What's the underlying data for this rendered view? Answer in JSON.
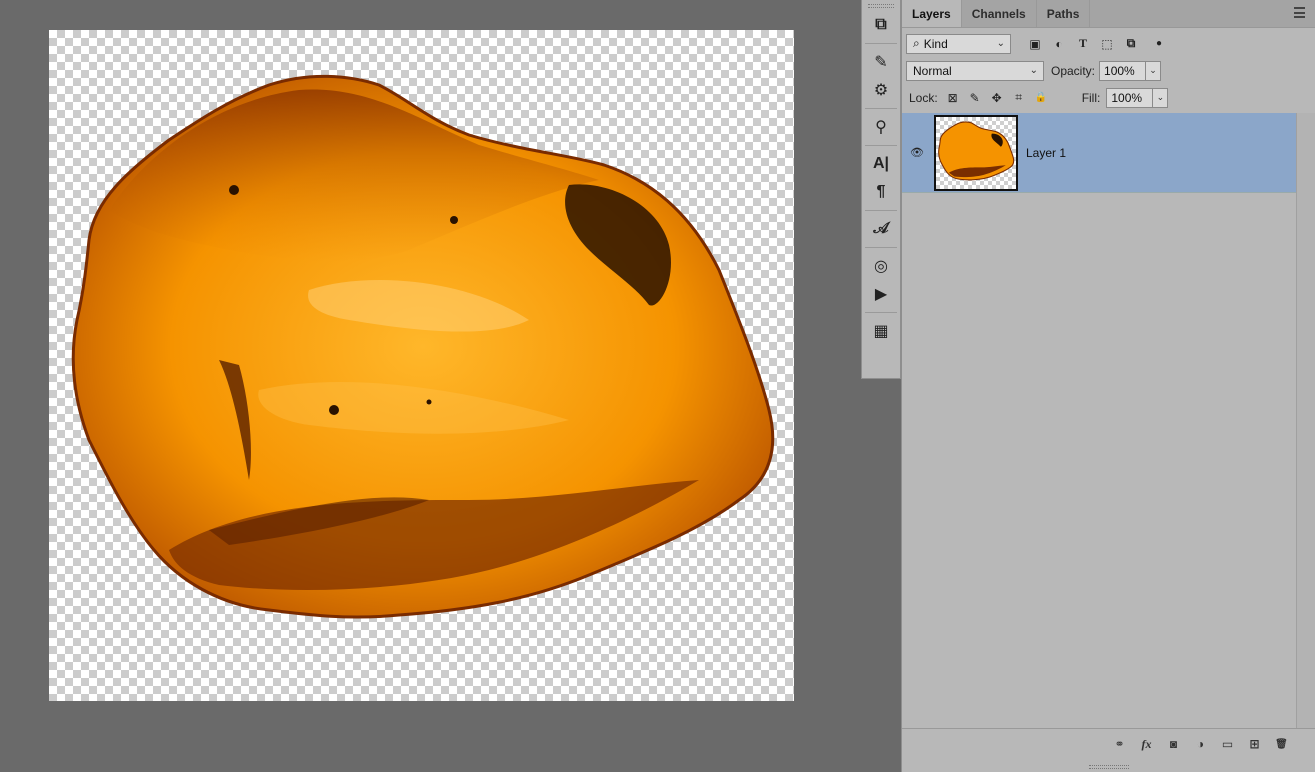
{
  "colors": {
    "amber_light": "#ffb300",
    "amber_mid": "#f08a00",
    "amber_dark": "#8a3300",
    "inclusion": "#2a1200",
    "selected_layer": "#8ba6c9"
  },
  "dock": {
    "buttons": [
      {
        "name": "layer-comps-icon",
        "glyph": "⧉"
      },
      {
        "name": "brushes-icon",
        "glyph": "✎"
      },
      {
        "name": "brush-settings-icon",
        "glyph": "⚙"
      },
      {
        "name": "clone-source-icon",
        "glyph": "⚲"
      },
      {
        "name": "character-icon",
        "glyph": "A|"
      },
      {
        "name": "paragraph-icon",
        "glyph": "¶"
      },
      {
        "name": "glyphs-icon",
        "glyph": "𝒜"
      },
      {
        "name": "libraries-icon",
        "glyph": "◎"
      },
      {
        "name": "actions-icon",
        "glyph": "▶"
      },
      {
        "name": "properties-icon",
        "glyph": "▦"
      }
    ]
  },
  "panel": {
    "tabs": [
      {
        "label": "Layers",
        "active": true
      },
      {
        "label": "Channels",
        "active": false
      },
      {
        "label": "Paths",
        "active": false
      }
    ],
    "filter": {
      "kind_icon": "⌕",
      "kind_label": "Kind",
      "icons": [
        {
          "name": "filter-pixel-icon",
          "glyph": "▣"
        },
        {
          "name": "filter-adjustment-icon",
          "glyph": "◐"
        },
        {
          "name": "filter-type-icon",
          "glyph": "T"
        },
        {
          "name": "filter-shape-icon",
          "glyph": "⬚"
        },
        {
          "name": "filter-smart-object-icon",
          "glyph": "⧉"
        },
        {
          "name": "filter-toggle-icon",
          "glyph": "●"
        }
      ]
    },
    "blend_mode": "Normal",
    "opacity_label": "Opacity:",
    "opacity_value": "100%",
    "lock_label": "Lock:",
    "lock_icons": [
      {
        "name": "lock-transparent-icon",
        "glyph": "⊠"
      },
      {
        "name": "lock-image-icon",
        "glyph": "✎"
      },
      {
        "name": "lock-position-icon",
        "glyph": "✥"
      },
      {
        "name": "lock-artboard-icon",
        "glyph": "⌗"
      },
      {
        "name": "lock-all-icon",
        "glyph": "🔒"
      }
    ],
    "fill_label": "Fill:",
    "fill_value": "100%",
    "layers": [
      {
        "name": "Layer 1",
        "visible": true,
        "selected": true
      }
    ],
    "footer_icons": [
      {
        "name": "link-layers-icon",
        "glyph": "⚭"
      },
      {
        "name": "layer-style-icon",
        "glyph": "fx"
      },
      {
        "name": "add-mask-icon",
        "glyph": "◙"
      },
      {
        "name": "new-adjustment-icon",
        "glyph": "◑"
      },
      {
        "name": "new-group-icon",
        "glyph": "▭"
      },
      {
        "name": "new-layer-icon",
        "glyph": "⊞"
      },
      {
        "name": "delete-layer-icon",
        "glyph": "🗑"
      }
    ]
  }
}
